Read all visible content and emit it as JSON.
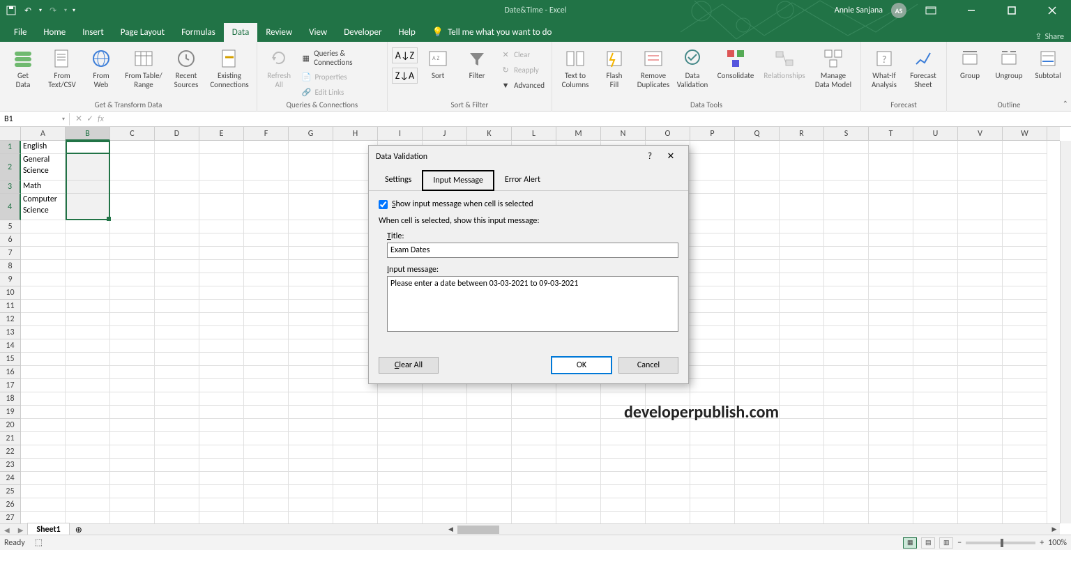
{
  "window": {
    "title": "Date&Time - Excel",
    "user": "Annie Sanjana",
    "avatar": "AS"
  },
  "qat": {
    "save": "💾",
    "undo": "↶",
    "redo": "↷"
  },
  "menu": {
    "tabs": [
      "File",
      "Home",
      "Insert",
      "Page Layout",
      "Formulas",
      "Data",
      "Review",
      "View",
      "Developer",
      "Help"
    ],
    "active": "Data",
    "tellme": "Tell me what you want to do",
    "share": "Share"
  },
  "ribbon": {
    "groups": {
      "get_transform": {
        "label": "Get & Transform Data",
        "get_data": "Get\nData",
        "from_textcsv": "From\nText/CSV",
        "from_web": "From\nWeb",
        "from_table": "From Table/\nRange",
        "recent": "Recent\nSources",
        "existing": "Existing\nConnections"
      },
      "queries": {
        "label": "Queries & Connections",
        "refresh": "Refresh\nAll",
        "qc": "Queries & Connections",
        "properties": "Properties",
        "edit_links": "Edit Links"
      },
      "sortfilter": {
        "label": "Sort & Filter",
        "sort": "Sort",
        "filter": "Filter",
        "clear": "Clear",
        "reapply": "Reapply",
        "advanced": "Advanced"
      },
      "datatools": {
        "label": "Data Tools",
        "text_to_cols": "Text to\nColumns",
        "flash_fill": "Flash\nFill",
        "remove_dup": "Remove\nDuplicates",
        "validation": "Data\nValidation",
        "consolidate": "Consolidate",
        "relationships": "Relationships",
        "data_model": "Manage\nData Model"
      },
      "forecast": {
        "label": "Forecast",
        "whatif": "What-If\nAnalysis",
        "forecast_sheet": "Forecast\nSheet"
      },
      "outline": {
        "label": "Outline",
        "group": "Group",
        "ungroup": "Ungroup",
        "subtotal": "Subtotal"
      }
    }
  },
  "namebox": {
    "value": "B1"
  },
  "columns": [
    "A",
    "B",
    "C",
    "D",
    "E",
    "F",
    "G",
    "H",
    "I",
    "J",
    "K",
    "L",
    "M",
    "N",
    "O",
    "P",
    "Q",
    "R",
    "S",
    "T",
    "U",
    "V",
    "W"
  ],
  "rows": [
    1,
    2,
    3,
    4,
    5,
    6,
    7,
    8,
    9,
    10,
    11,
    12,
    13,
    14,
    15,
    16,
    17,
    18,
    19,
    20,
    21,
    22,
    23,
    24,
    25,
    26,
    27
  ],
  "cells": {
    "A1": "English",
    "A2": "General Science",
    "A3": "Math",
    "A4": "Computer Science"
  },
  "sheettabs": {
    "active": "Sheet1"
  },
  "status": {
    "left": "Ready",
    "zoom": "100%"
  },
  "dialog": {
    "title": "Data Validation",
    "tabs": {
      "settings": "Settings",
      "input_message": "Input Message",
      "error_alert": "Error Alert"
    },
    "checkbox_label": "Show input message when cell is selected",
    "checkbox_underline_letter": "S",
    "subheading": "When cell is selected, show this input message:",
    "title_label": "Title:",
    "title_underline": "T",
    "title_value": "Exam Dates",
    "message_label": "Input message:",
    "message_underline": "I",
    "message_value": "Please enter a date between 03-03-2021 to 09-03-2021",
    "clear_all": "Clear All",
    "clear_underline": "C",
    "ok": "OK",
    "cancel": "Cancel",
    "help": "?",
    "close": "✕"
  },
  "watermark": "developerpublish.com"
}
